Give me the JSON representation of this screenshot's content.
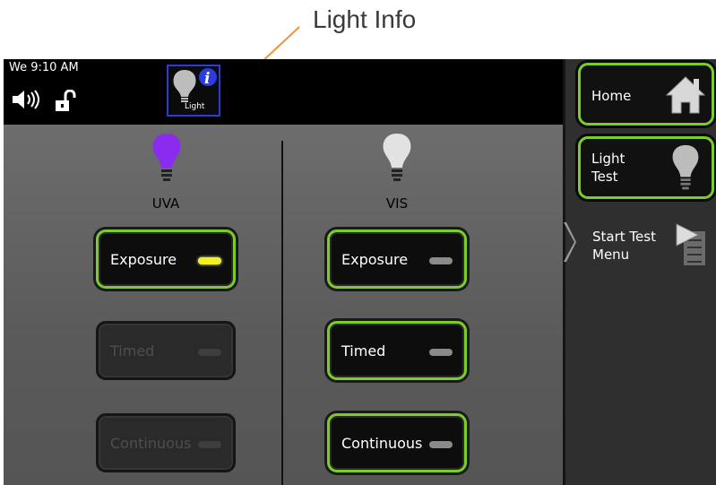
{
  "annotation": {
    "label": "Light Info",
    "color": "#f0943a"
  },
  "status": {
    "clock": "We 9:10 AM"
  },
  "light_info_button": {
    "label": "Light"
  },
  "columns": [
    {
      "label": "UVA",
      "bulb_color": "#8a2bf0",
      "buttons": [
        {
          "label": "Exposure",
          "enabled": true,
          "led": "on"
        },
        {
          "label": "Timed",
          "enabled": false,
          "led": "off"
        },
        {
          "label": "Continuous",
          "enabled": false,
          "led": "off"
        }
      ]
    },
    {
      "label": "VIS",
      "bulb_color": "#e2e2e2",
      "buttons": [
        {
          "label": "Exposure",
          "enabled": true,
          "led": "off"
        },
        {
          "label": "Timed",
          "enabled": true,
          "led": "off"
        },
        {
          "label": "Continuous",
          "enabled": true,
          "led": "off"
        }
      ]
    }
  ],
  "sidebar": {
    "home": {
      "label": "Home",
      "icon": "home-icon"
    },
    "light_test": {
      "line1": "Light",
      "line2": "Test",
      "icon": "lightbulb-icon"
    },
    "start_test": {
      "line1": "Start Test",
      "line2": "Menu",
      "icon": "menu-flag-icon"
    }
  },
  "colors": {
    "accent": "#7ccd2a",
    "led_on": "#f2f223",
    "info_border": "#2b3bd6"
  }
}
